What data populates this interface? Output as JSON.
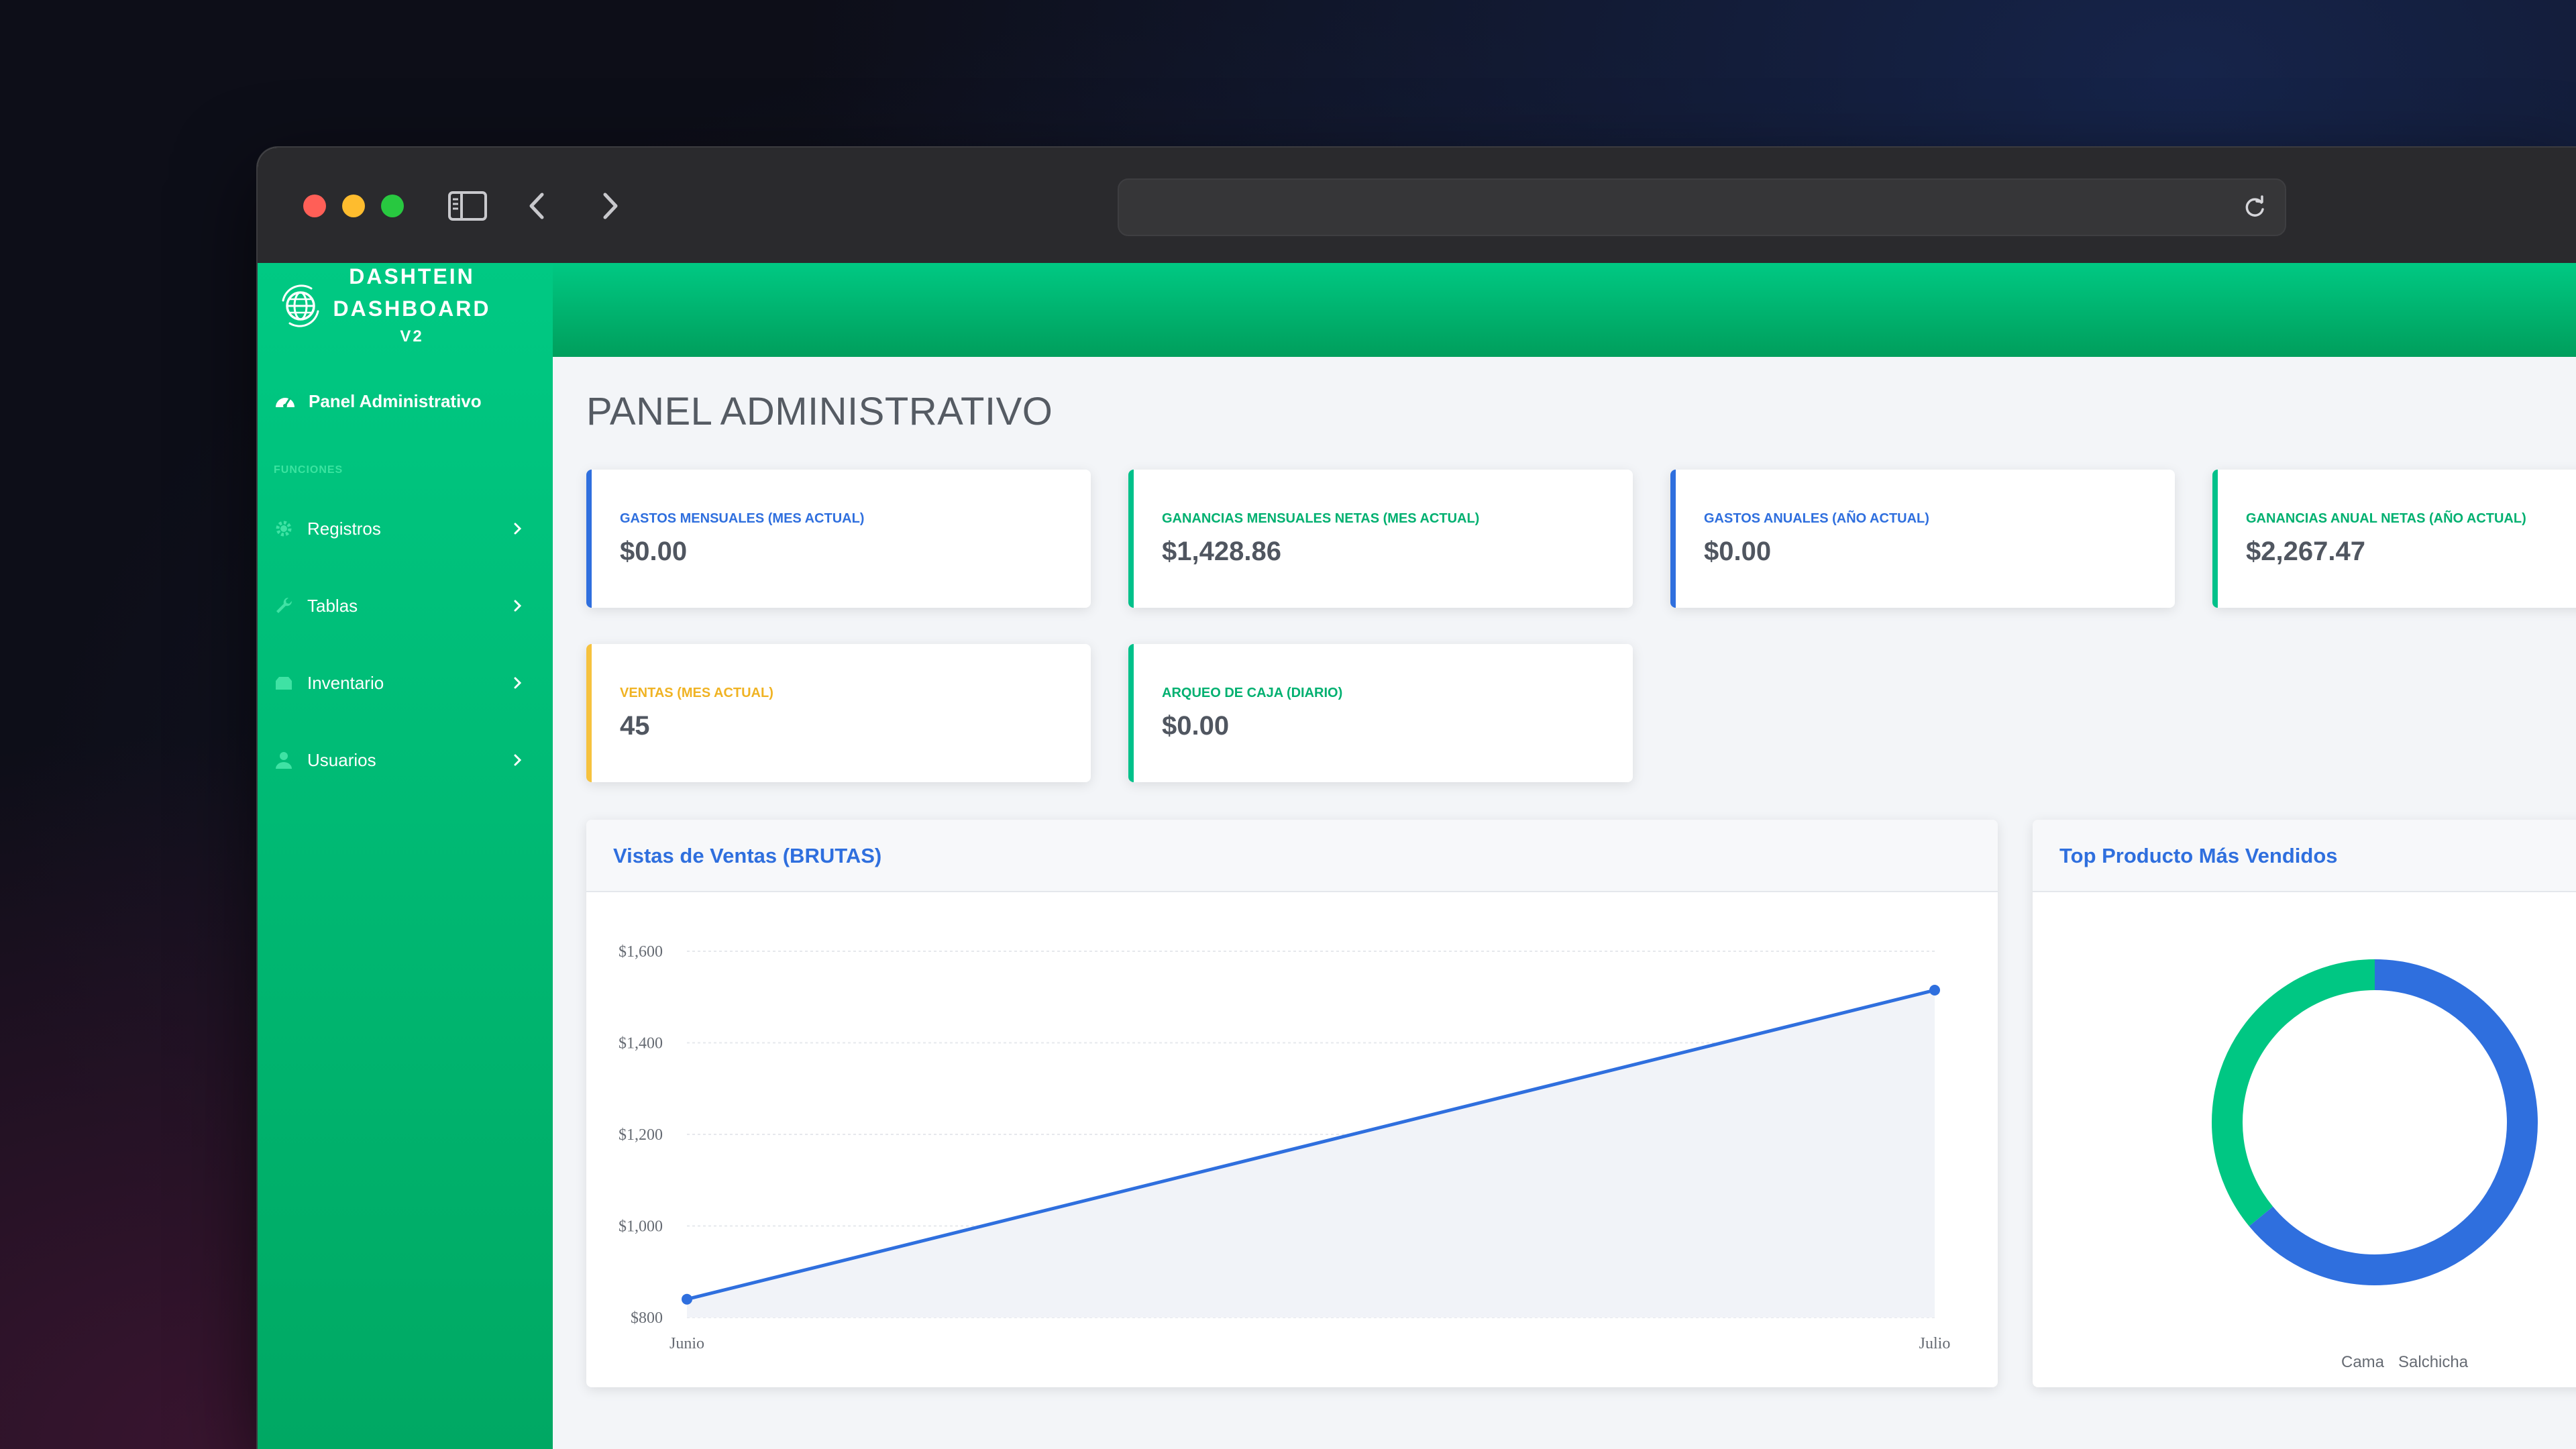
{
  "brand": {
    "line1": "DASHTEIN",
    "line2": "DASHBOARD",
    "line3": "V2"
  },
  "sidebar": {
    "main_item": "Panel Administrativo",
    "section_heading": "FUNCIONES",
    "items": [
      {
        "label": "Registros",
        "icon": "gear-icon"
      },
      {
        "label": "Tablas",
        "icon": "wrench-icon"
      },
      {
        "label": "Inventario",
        "icon": "box-icon"
      },
      {
        "label": "Usuarios",
        "icon": "user-icon"
      }
    ]
  },
  "page": {
    "title": "PANEL ADMINISTRATIVO"
  },
  "cards": [
    {
      "label": "Gastos Mensuales (Mes Actual)",
      "value": "$0.00"
    },
    {
      "label": "Ganancias Mensuales Netas (Mes Actual)",
      "value": "$1,428.86"
    },
    {
      "label": "Gastos Anuales (Año Actual)",
      "value": "$0.00"
    },
    {
      "label": "Ganancias Anual Netas (Año Actual)",
      "value": "$2,267.47"
    },
    {
      "label": "Ventas (Mes Actual)",
      "value": "45"
    },
    {
      "label": "Arqueo de Caja (Diario)",
      "value": "$0.00"
    }
  ],
  "colors": {
    "primary": "#2f6fde",
    "teal": "#00c18a",
    "amber": "#f6c23e",
    "sidebar": "#00b874"
  },
  "line_panel": {
    "title": "Vistas de Ventas (BRUTAS)"
  },
  "donut_panel": {
    "title": "Top Producto Más Vendidos"
  },
  "chart_data": [
    {
      "type": "line",
      "title": "Vistas de Ventas (BRUTAS)",
      "categories": [
        "Junio",
        "Julio"
      ],
      "values": [
        840,
        1515
      ],
      "ylim": [
        800,
        1600
      ],
      "yticks": [
        800,
        1000,
        1200,
        1400,
        1600
      ],
      "ytick_labels": [
        "$800",
        "$1,000",
        "$1,200",
        "$1,400",
        "$1,600"
      ],
      "grid": true
    },
    {
      "type": "pie",
      "title": "Top Producto Más Vendidos",
      "labels": [
        "Cama",
        "Salchicha"
      ],
      "values": [
        36,
        64
      ],
      "colors": [
        "#00c783",
        "#2f6fde"
      ],
      "legend": "bottom"
    }
  ]
}
